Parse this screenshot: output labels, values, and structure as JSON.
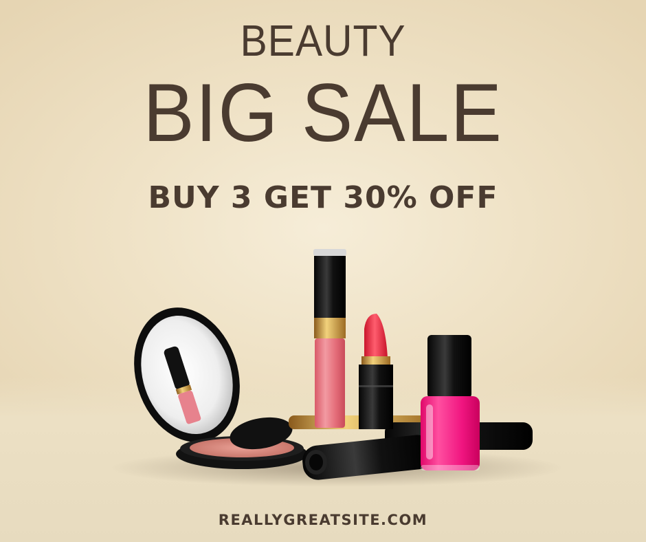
{
  "header": {
    "line1": "BEAUTY",
    "line2": "BIG SALE"
  },
  "offer": {
    "text": "BUY 3 GET 30% OFF"
  },
  "footer": {
    "website": "REALLYGREATSITE.COM"
  },
  "colors": {
    "background": "#efe2c6",
    "text": "#4a3b30",
    "lipstick": "#e8334a",
    "nail_polish": "#f0187a",
    "lip_gloss": "#e9707c"
  }
}
